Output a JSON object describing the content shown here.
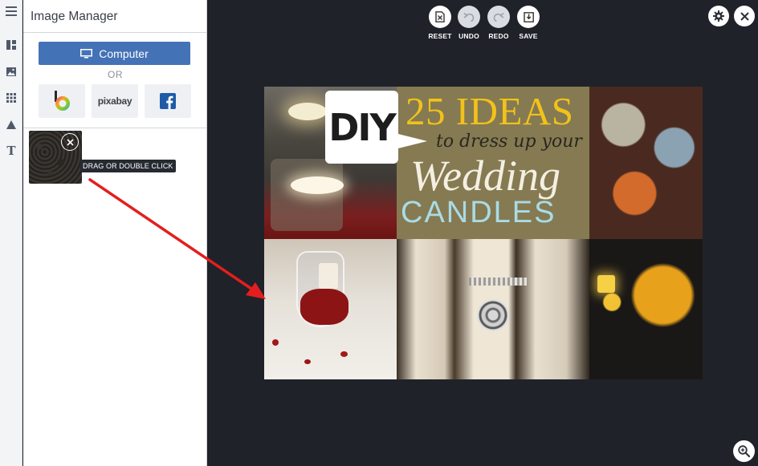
{
  "sidebar_rail": {
    "items": [
      {
        "icon": "menu-icon"
      },
      {
        "icon": "layout-icon"
      },
      {
        "icon": "image-icon"
      },
      {
        "icon": "grid-icon"
      },
      {
        "icon": "shape-icon"
      },
      {
        "icon": "text-icon",
        "glyph": "T"
      }
    ]
  },
  "image_manager": {
    "title": "Image Manager",
    "computer_button_label": "Computer",
    "or_label": "OR",
    "sources": [
      {
        "name": "behance",
        "icon": "behance-logo-icon"
      },
      {
        "name": "pixabay",
        "label": "pixabay"
      },
      {
        "name": "facebook",
        "icon": "facebook-logo-icon"
      }
    ],
    "thumbnail_tooltip": "DRAG OR DOUBLE CLICK"
  },
  "toolbar": {
    "reset_label": "RESET",
    "undo_label": "UNDO",
    "redo_label": "REDO",
    "save_label": "SAVE"
  },
  "canvas": {
    "diy_text": "DIY",
    "headline_ideas": "25 IDEAS",
    "headline_sub": "to dress up your",
    "headline_wedding": "Wedding",
    "headline_candles": "CANDLES"
  },
  "colors": {
    "workspace_bg": "#1f2229",
    "accent_blue": "#4472b6",
    "arrow_red": "#e41e1e",
    "ideas_yellow": "#f2c21a"
  }
}
